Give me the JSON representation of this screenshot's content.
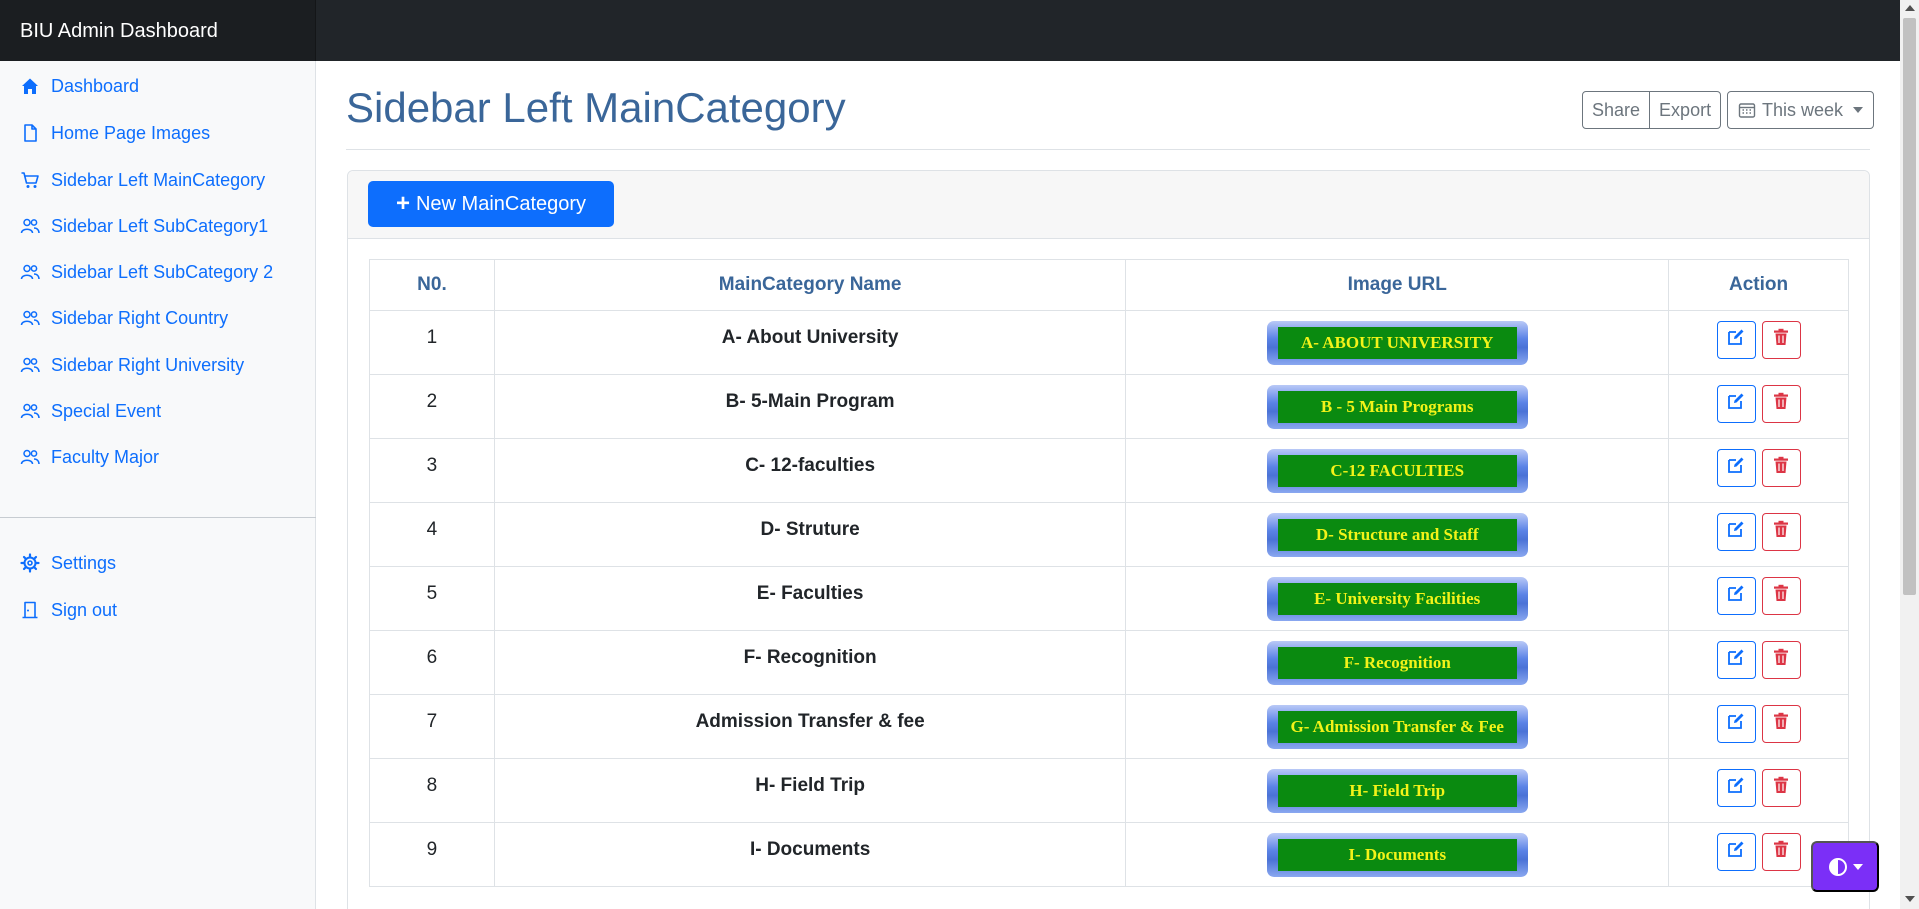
{
  "app": {
    "brand": "BIU Admin Dashboard"
  },
  "sidebar": {
    "items": [
      {
        "label": "Dashboard",
        "icon": "home-icon"
      },
      {
        "label": "Home Page Images",
        "icon": "file-icon"
      },
      {
        "label": "Sidebar Left MainCategory",
        "icon": "cart-icon"
      },
      {
        "label": "Sidebar Left SubCategory1",
        "icon": "users-icon"
      },
      {
        "label": "Sidebar Left SubCategory 2",
        "icon": "users-icon"
      },
      {
        "label": "Sidebar Right Country",
        "icon": "users-icon"
      },
      {
        "label": "Sidebar Right University",
        "icon": "users-icon"
      },
      {
        "label": "Special Event",
        "icon": "users-icon"
      },
      {
        "label": "Faculty Major",
        "icon": "users-icon"
      }
    ],
    "bottom": [
      {
        "label": "Settings",
        "icon": "gear-icon"
      },
      {
        "label": "Sign out",
        "icon": "door-icon"
      }
    ]
  },
  "main": {
    "title": "Sidebar Left MainCategory",
    "share_label": "Share",
    "export_label": "Export",
    "period_label": "This week",
    "new_button_label": "New MainCategory"
  },
  "table": {
    "headers": [
      "N0.",
      "MainCategory Name",
      "Image URL",
      "Action"
    ],
    "rows": [
      {
        "no": "1",
        "name": "A- About University",
        "image_text": "A- ABOUT UNIVERSITY"
      },
      {
        "no": "2",
        "name": "B- 5-Main Program",
        "image_text": "B - 5 Main Programs"
      },
      {
        "no": "3",
        "name": "C- 12-faculties",
        "image_text": "C-12 FACULTIES"
      },
      {
        "no": "4",
        "name": "D- Struture",
        "image_text": "D- Structure and Staff"
      },
      {
        "no": "5",
        "name": "E- Faculties",
        "image_text": "E- University Facilities"
      },
      {
        "no": "6",
        "name": "F- Recognition",
        "image_text": "F- Recognition"
      },
      {
        "no": "7",
        "name": "Admission Transfer & fee",
        "image_text": "G- Admission Transfer & Fee"
      },
      {
        "no": "8",
        "name": "H- Field Trip",
        "image_text": "H- Field Trip"
      },
      {
        "no": "9",
        "name": "I- Documents",
        "image_text": "I- Documents"
      }
    ]
  },
  "colors": {
    "navbar": "#212529",
    "sidebar_bg": "#f8f9fa",
    "link": "#0d6efd",
    "title": "#3a6699",
    "delete": "#dc3545",
    "image_bg": "#0a8a10",
    "image_text": "#f3f319",
    "theme_button": "#7b2ff7"
  }
}
